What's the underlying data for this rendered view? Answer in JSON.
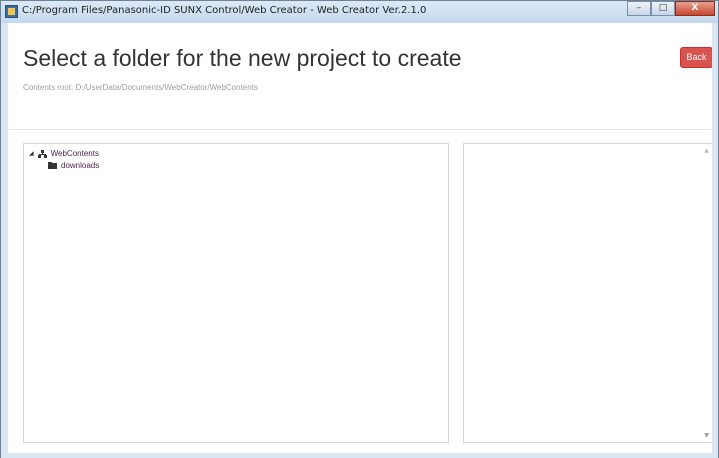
{
  "window": {
    "title": "C:/Program Files/Panasonic-ID SUNX Control/Web Creator - Web Creator Ver.2.1.0",
    "controls": {
      "minimize": "–",
      "maximize": "□",
      "close": "X"
    }
  },
  "header": {
    "title": "Select a folder for the new project to create",
    "contents_root": "Contents root: D:/UserData/Documents/WebCreator/WebContents",
    "back_label": "Back"
  },
  "tree": {
    "root": {
      "label": "WebContents",
      "expanded": true,
      "icon": "sitemap-icon"
    },
    "children": [
      {
        "label": "downloads",
        "icon": "folder-icon"
      }
    ]
  },
  "colors": {
    "back_button": "#d9534f",
    "tree_text": "#4a1f4a"
  }
}
